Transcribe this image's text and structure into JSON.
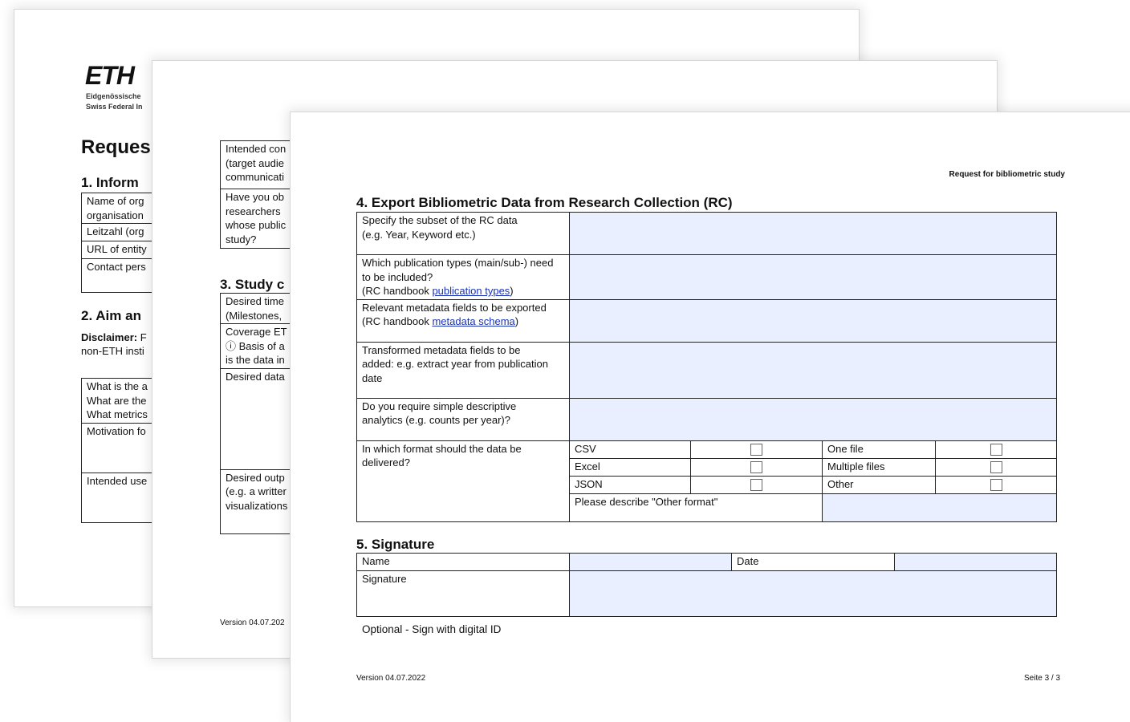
{
  "page1": {
    "logo_text": "ETH",
    "logo_sub_line1": "Eidgenössische",
    "logo_sub_line2": "Swiss Federal In",
    "title": "Reques",
    "section1_title": "1.  Inform",
    "section1_rows": [
      "Name of org\norganisation",
      "Leitzahl (org",
      "URL of entity",
      "Contact pers"
    ],
    "section2_title": "2.  Aim an",
    "disclaimer_label": "Disclaimer:",
    "disclaimer_rest": " F",
    "disclaimer_line2": "non-ETH insti",
    "section2_rows": [
      "What is the a\nWhat are the\nWhat metrics",
      "Motivation fo",
      "Intended use"
    ]
  },
  "page2": {
    "rows_top": [
      "Intended con\n(target audie\ncommunicati",
      "Have you ob\nresearchers \nwhose public\nstudy?"
    ],
    "section3_title": "3.  Study c",
    "rows_study": [
      "Desired time\n(Milestones,",
      "Coverage ET\nⓘ Basis of a\nis the data in",
      "Desired data",
      "Desired outp\n(e.g. a writter\nvisualizations"
    ],
    "footer_version": "Version 04.07.202"
  },
  "page3": {
    "header_right": "Request for bibliometric study",
    "section4_title": "4.  Export Bibliometric Data from Research Collection (RC)",
    "q1": "Specify the subset of the RC data\n(e.g. Year, Keyword etc.)",
    "q2_text": "Which publication types (main/sub-) need\nto be included?\n(RC handbook ",
    "q2_link": "publication types",
    "q2_close": ")",
    "q3_text": "Relevant metadata fields to be exported\n(RC handbook ",
    "q3_link": "metadata schema",
    "q3_close": ")",
    "q4": "Transformed metadata fields to be\nadded: e.g. extract year from publication\ndate",
    "q5": "Do you require simple descriptive\nanalytics (e.g. counts per year)?",
    "q6": "In which format should the data be\ndelivered?",
    "formats": [
      "CSV",
      "Excel",
      "JSON"
    ],
    "file_options": [
      "One file",
      "Multiple files",
      "Other"
    ],
    "other_format_label": "Please describe \"Other format\"",
    "section5_title": "5.  Signature",
    "name_label": "Name",
    "date_label": "Date",
    "signature_label": "Signature",
    "optional_note": "Optional - Sign with digital ID",
    "footer_version": "Version 04.07.2022",
    "footer_page": "Seite  3 / 3"
  },
  "colors": {
    "field_fill": "#eaefff",
    "link": "#1a33b8",
    "border": "#222222"
  }
}
